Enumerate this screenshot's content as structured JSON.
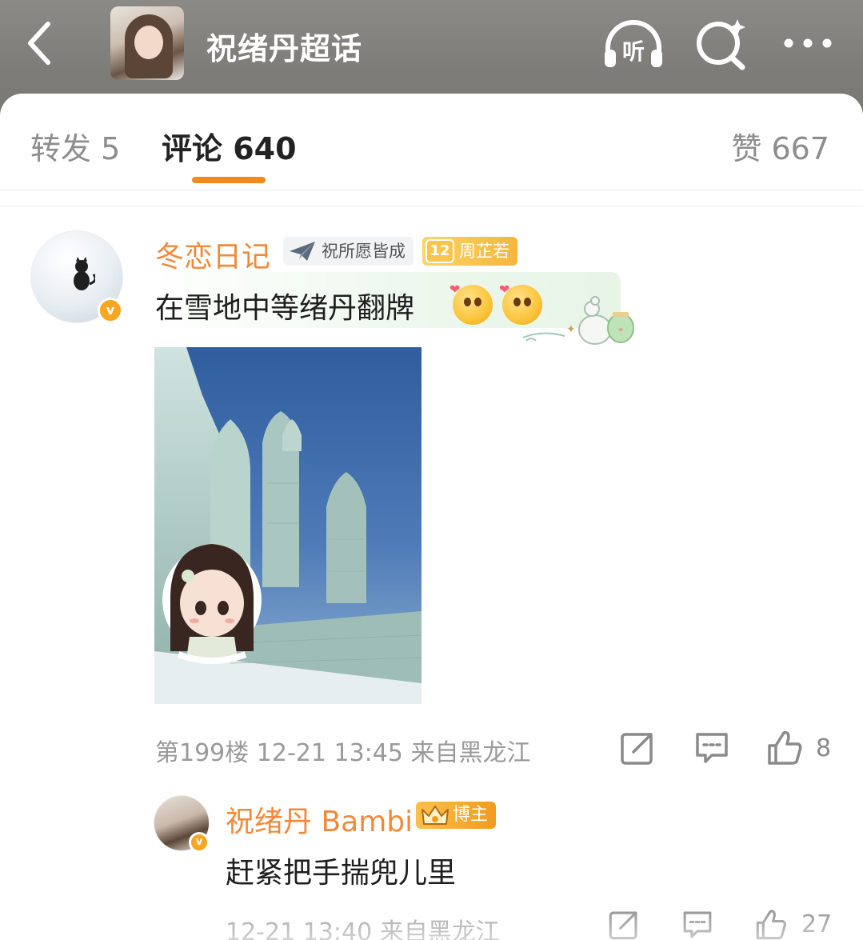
{
  "header": {
    "title": "祝绪丹超话",
    "back_icon": "chevron-left-icon",
    "listen_icon": "headphones-icon",
    "listen_label": "听",
    "search_icon": "search-sparkle-icon",
    "more_icon": "more-dots-icon"
  },
  "tabs": {
    "repost": "转发 5",
    "comment": "评论 640",
    "like": "赞 667",
    "active": "comment",
    "accent_color": "#f08a1c"
  },
  "comment": {
    "user_name": "冬恋日记",
    "verified_badge": "v",
    "fan_badge": "祝所愿皆成",
    "level_num": "12",
    "level_label": "周芷若",
    "text": "在雪地中等绪丹翻牌",
    "meta": "第199楼 12-21 13:45 来自黑龙江",
    "like_count": "8",
    "name_color": "#f08a3a"
  },
  "reply": {
    "user_name": "祝绪丹 Bambi",
    "verified_badge": "v",
    "host_badge": "博主",
    "text": "赶紧把手揣兜儿里",
    "meta": "12-21 13:40 来自黑龙江",
    "like_count": "27"
  }
}
